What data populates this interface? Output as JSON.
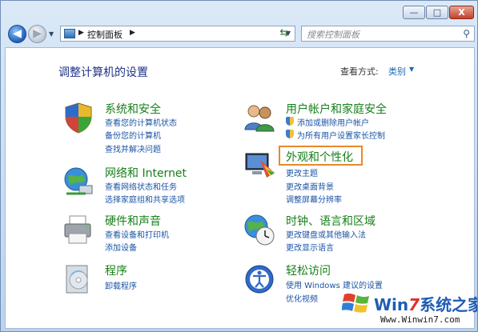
{
  "window": {
    "caption_buttons": {
      "minimize": "—",
      "maximize": "□",
      "close": "X"
    }
  },
  "addressbar": {
    "breadcrumb": "控制面板",
    "search_placeholder": "搜索控制面板"
  },
  "header": {
    "title": "调整计算机的设置",
    "view_by_label": "查看方式:",
    "view_by_value": "类别"
  },
  "categories": [
    {
      "id": "system-security",
      "title": "系统和安全",
      "icon": "shield-check-icon",
      "links": [
        "查看您的计算机状态",
        "备份您的计算机",
        "查找并解决问题"
      ]
    },
    {
      "id": "network",
      "title": "网络和 Internet",
      "icon": "network-globe-icon",
      "links": [
        "查看网络状态和任务",
        "选择家庭组和共享选项"
      ]
    },
    {
      "id": "hardware",
      "title": "硬件和声音",
      "icon": "printer-icon",
      "links": [
        "查看设备和打印机",
        "添加设备"
      ]
    },
    {
      "id": "programs",
      "title": "程序",
      "icon": "programs-disc-icon",
      "links": [
        "卸载程序"
      ]
    },
    {
      "id": "user-accounts",
      "title": "用户帐户和家庭安全",
      "icon": "users-icon",
      "links": [
        "添加或删除用户帐户",
        "为所有用户设置家长控制"
      ]
    },
    {
      "id": "appearance",
      "title": "外观和个性化",
      "icon": "monitor-palette-icon",
      "links": [
        "更改主题",
        "更改桌面背景",
        "调整屏幕分辨率"
      ]
    },
    {
      "id": "clock-region",
      "title": "时钟、语言和区域",
      "icon": "clock-globe-icon",
      "links": [
        "更改键盘或其他输入法",
        "更改显示语言"
      ]
    },
    {
      "id": "ease-access",
      "title": "轻松访问",
      "icon": "ease-of-access-icon",
      "links": [
        "使用 Windows 建议的设置",
        "优化视频"
      ]
    }
  ],
  "watermark": {
    "brand_prefix": "Win",
    "brand_seven": "7",
    "brand_suffix": "系统之家",
    "url": "Www.Winwin7.com"
  },
  "colors": {
    "category_title": "#167f1a",
    "link": "#1b54a6",
    "title": "#1e3287",
    "highlight": "#e58a2a"
  }
}
